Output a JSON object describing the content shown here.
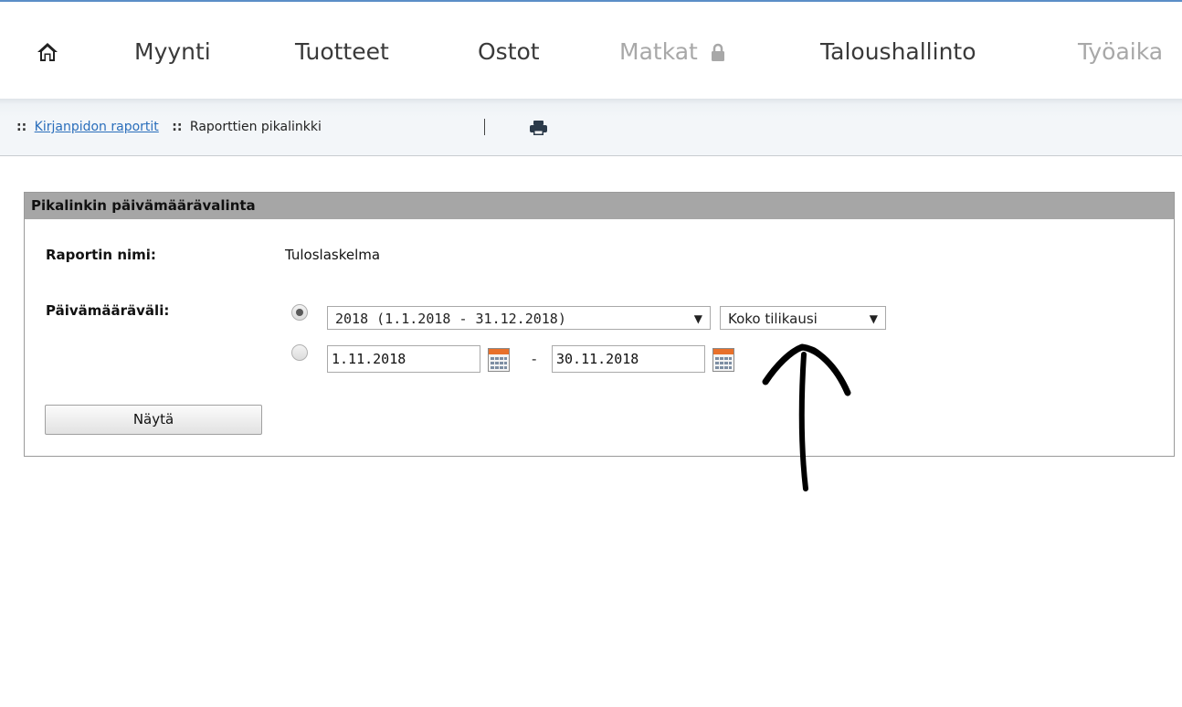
{
  "nav": {
    "home_icon": "home-icon",
    "items": [
      {
        "label": "Myynti",
        "enabled": true
      },
      {
        "label": "Tuotteet",
        "enabled": true
      },
      {
        "label": "Ostot",
        "enabled": true
      },
      {
        "label": "Matkat",
        "enabled": false,
        "icon": "lock-icon"
      },
      {
        "label": "Taloushallinto",
        "enabled": true
      },
      {
        "label": "Työaika",
        "enabled": false
      }
    ]
  },
  "breadcrumb": {
    "separator": "::",
    "link": "Kirjanpidon raportit",
    "current": "Raporttien pikalinkki",
    "print_icon": "print-icon"
  },
  "panel": {
    "title": "Pikalinkin päivämäärävalinta",
    "report_name_label": "Raportin nimi:",
    "report_name_value": "Tuloslaskelma",
    "date_range_label": "Päivämääräväli:",
    "period_select": "2018 (1.1.2018 - 31.12.2018)",
    "scope_select": "Koko tilikausi",
    "date_from": "1.11.2018",
    "date_separator": "-",
    "date_to": "30.11.2018",
    "radio_selected": "period",
    "show_button": "Näytä"
  },
  "colors": {
    "accent": "#5b8ec7",
    "link": "#2a6ebb",
    "panel_header": "#a6a6a6",
    "disabled_text": "#a8a8a8"
  },
  "annotation": "hand-drawn-arrow"
}
